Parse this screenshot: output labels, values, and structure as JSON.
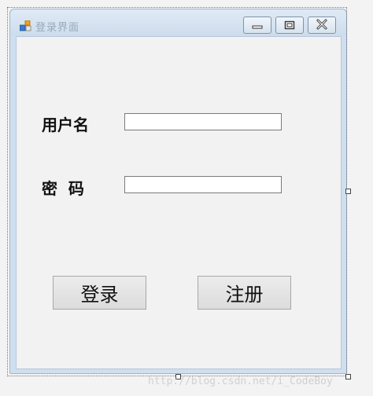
{
  "window": {
    "title": "登录界面",
    "controls": {
      "minimize": "minimize-icon",
      "maximize": "maximize-icon",
      "close": "close-icon"
    }
  },
  "form": {
    "username_label": "用户名",
    "username_value": "",
    "password_label": "密  码",
    "password_value": ""
  },
  "buttons": {
    "login_label": "登录",
    "register_label": "注册"
  },
  "watermark": "http://blog.csdn.net/i_CodeBoy",
  "colors": {
    "titlebar": "#cddcec",
    "client": "#f2f2f2",
    "button_face": "#e1e1e1"
  }
}
